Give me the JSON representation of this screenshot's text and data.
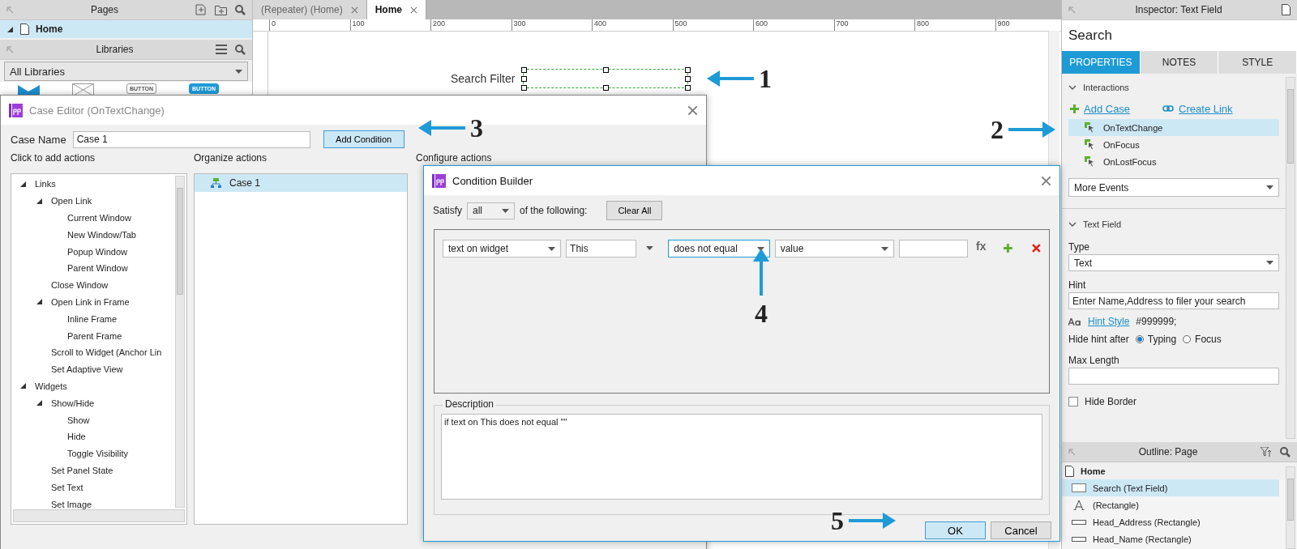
{
  "pages_panel": {
    "title": "Pages",
    "items": [
      {
        "label": "Home",
        "expanded": true,
        "selected": true
      }
    ]
  },
  "libraries_panel": {
    "title": "Libraries",
    "dropdown": "All Libraries",
    "widgets": [
      {
        "kind": "image"
      },
      {
        "kind": "placeholder"
      },
      {
        "kind": "button",
        "label": "BUTTON"
      },
      {
        "kind": "primary-button",
        "label": "BUTTON"
      }
    ]
  },
  "document_tabs": [
    {
      "label": "(Repeater) (Home)",
      "selected": false
    },
    {
      "label": "Home",
      "selected": true
    }
  ],
  "ruler": {
    "marks": [
      "0",
      "100",
      "200",
      "300",
      "400",
      "500",
      "600",
      "700",
      "800",
      "900"
    ]
  },
  "canvas": {
    "label": "Search Filter",
    "text_field": {
      "selected": true
    }
  },
  "inspector": {
    "title": "Inspector: Text Field",
    "widget_name": "Search",
    "tabs": [
      {
        "label": "PROPERTIES",
        "selected": true
      },
      {
        "label": "NOTES",
        "selected": false
      },
      {
        "label": "STYLE",
        "selected": false
      }
    ],
    "interactions": {
      "title": "Interactions",
      "add_case": "Add Case",
      "create_link": "Create Link",
      "events": [
        {
          "label": "OnTextChange",
          "selected": true
        },
        {
          "label": "OnFocus",
          "selected": false
        },
        {
          "label": "OnLostFocus",
          "selected": false
        }
      ],
      "more_events": "More Events"
    },
    "text_field": {
      "title": "Text Field",
      "type_label": "Type",
      "type_value": "Text",
      "hint_label": "Hint",
      "hint_value": "Enter Name,Address to filer your search",
      "hint_style_link": "Hint Style",
      "hint_style_value": "#999999;",
      "hide_hint_label": "Hide hint after",
      "hide_hint_options": [
        {
          "label": "Typing",
          "selected": true
        },
        {
          "label": "Focus",
          "selected": false
        }
      ],
      "max_length_label": "Max Length",
      "hide_border": {
        "label": "Hide Border",
        "checked": false
      }
    }
  },
  "outline": {
    "title": "Outline: Page",
    "root": "Home",
    "items": [
      {
        "label": "Search (Text Field)",
        "kind": "field",
        "selected": true
      },
      {
        "label": "(Rectangle)",
        "kind": "text",
        "selected": false
      },
      {
        "label": "Head_Address (Rectangle)",
        "kind": "rectangle",
        "selected": false
      },
      {
        "label": "Head_Name (Rectangle)",
        "kind": "rectangle",
        "selected": false
      }
    ]
  },
  "case_editor": {
    "title": "Case Editor (OnTextChange)",
    "case_name_label": "Case Name",
    "case_name": "Case 1",
    "add_condition": "Add Condition",
    "actions_label": "Click to add actions",
    "organize_label": "Organize actions",
    "configure_label": "Configure actions",
    "actions": [
      {
        "label": "Links",
        "expanded": true,
        "children": [
          {
            "label": "Open Link",
            "expanded": true,
            "children": [
              {
                "label": "Current Window"
              },
              {
                "label": "New Window/Tab"
              },
              {
                "label": "Popup Window"
              },
              {
                "label": "Parent Window"
              }
            ]
          },
          {
            "label": "Close Window"
          },
          {
            "label": "Open Link in Frame",
            "expanded": true,
            "children": [
              {
                "label": "Inline Frame"
              },
              {
                "label": "Parent Frame"
              }
            ]
          },
          {
            "label": "Scroll to Widget (Anchor Lin"
          },
          {
            "label": "Set Adaptive View"
          }
        ]
      },
      {
        "label": "Widgets",
        "expanded": true,
        "children": [
          {
            "label": "Show/Hide",
            "expanded": true,
            "children": [
              {
                "label": "Show"
              },
              {
                "label": "Hide"
              },
              {
                "label": "Toggle Visibility"
              }
            ]
          },
          {
            "label": "Set Panel State"
          },
          {
            "label": "Set Text"
          },
          {
            "label": "Set Image"
          }
        ]
      }
    ],
    "cases": [
      {
        "label": "Case 1",
        "selected": true
      }
    ]
  },
  "condition_builder": {
    "title": "Condition Builder",
    "satisfy_label": "Satisfy",
    "satisfy_value": "all",
    "following_label": "of the following:",
    "clear_all": "Clear All",
    "condition": {
      "subject": "text on widget",
      "target": "This",
      "operator": "does not equal",
      "value_type": "value",
      "fx": "fx"
    },
    "description_label": "Description",
    "description": "if text on This does not equal \"\"",
    "ok": "OK",
    "cancel": "Cancel"
  },
  "annotations": [
    {
      "number": "1",
      "kind": "arrow-left"
    },
    {
      "number": "2",
      "kind": "arrow-right"
    },
    {
      "number": "3",
      "kind": "arrow-left"
    },
    {
      "number": "4",
      "kind": "arrow-up"
    },
    {
      "number": "5",
      "kind": "arrow-right"
    }
  ]
}
